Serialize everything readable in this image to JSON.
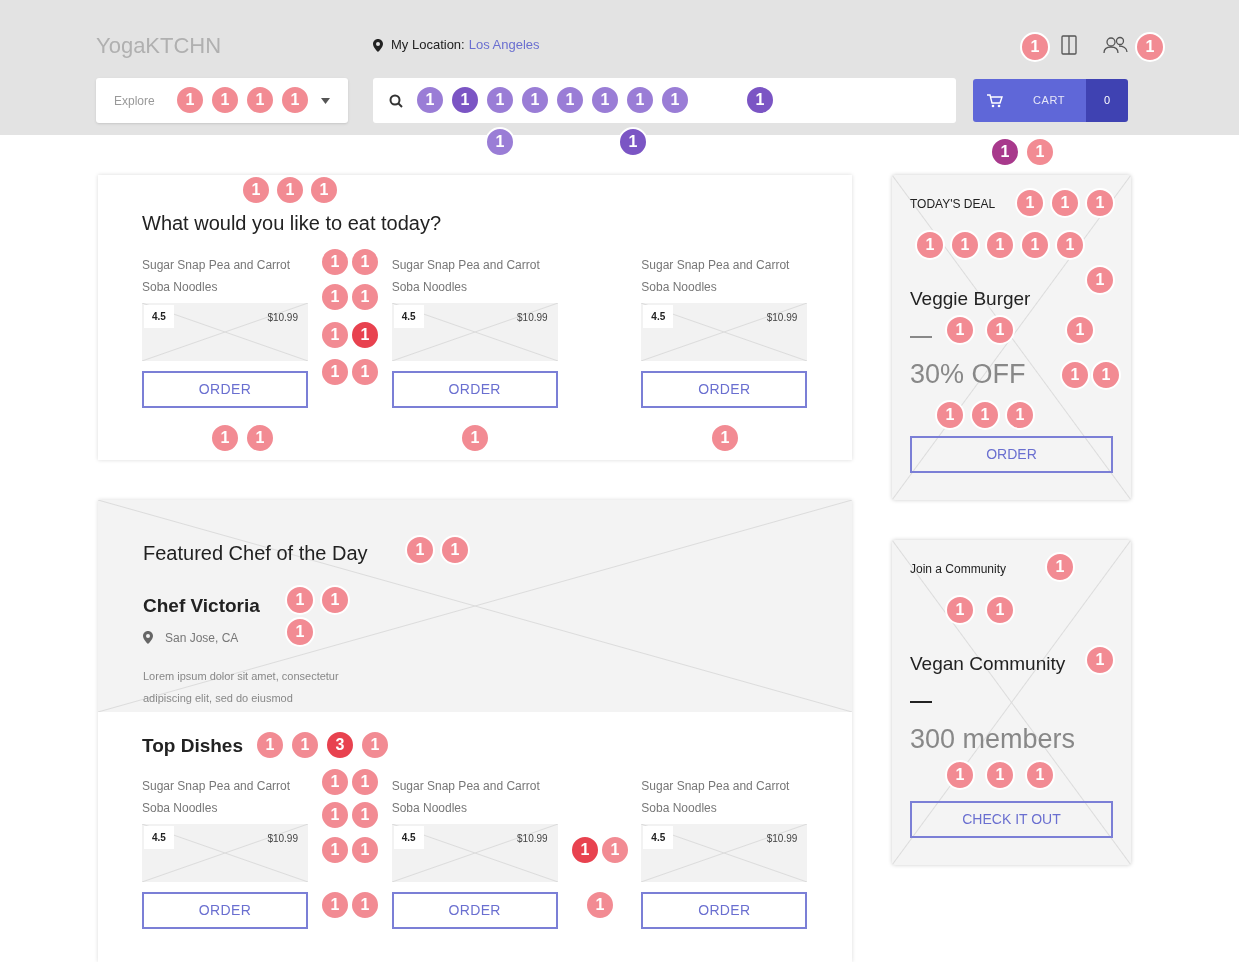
{
  "header": {
    "logo": "YogaKTCHN",
    "location_label": "My Location:",
    "location": "Los Angeles",
    "explore": "Explore",
    "cart": "CART",
    "cart_count": "0"
  },
  "eat_today": {
    "title": "What would you like to eat today?",
    "dishes": [
      {
        "name": "Sugar Snap Pea and Carrot Soba Noodles",
        "rating": "4.5",
        "price": "$10.99",
        "button": "ORDER"
      },
      {
        "name": "Sugar Snap Pea and Carrot Soba Noodles",
        "rating": "4.5",
        "price": "$10.99",
        "button": "ORDER"
      },
      {
        "name": "Sugar Snap Pea and Carrot Soba Noodles",
        "rating": "4.5",
        "price": "$10.99",
        "button": "ORDER"
      }
    ]
  },
  "featured": {
    "title": "Featured Chef of the Day",
    "chef": "Chef Victoria",
    "place": "San Jose, CA",
    "bio": "Lorem ipsum dolor sit amet, consectetur adipiscing elit, sed do eiusmod"
  },
  "top_dishes": {
    "title": "Top Dishes",
    "dishes": [
      {
        "name": "Sugar Snap Pea and Carrot Soba Noodles",
        "rating": "4.5",
        "price": "$10.99",
        "button": "ORDER"
      },
      {
        "name": "Sugar Snap Pea and Carrot Soba Noodles",
        "rating": "4.5",
        "price": "$10.99",
        "button": "ORDER"
      },
      {
        "name": "Sugar Snap Pea and Carrot Soba Noodles",
        "rating": "4.5",
        "price": "$10.99",
        "button": "ORDER"
      }
    ]
  },
  "deal": {
    "label": "TODAY'S DEAL",
    "item": "Veggie Burger",
    "offer": "30% OFF",
    "button": "ORDER"
  },
  "community": {
    "label": "Join a Community",
    "name": "Vegan Community",
    "members": "300 members",
    "button": "CHECK IT OUT"
  },
  "click_markers": [
    {
      "label": "1",
      "color": "#f28b93"
    },
    {
      "label": "1",
      "color": "#f28b93"
    },
    {
      "label": "1",
      "color": "#f28b93"
    },
    {
      "label": "1",
      "color": "#f28b93"
    },
    {
      "label": "1",
      "color": "#f28b93"
    },
    {
      "label": "1",
      "color": "#f28b93"
    },
    {
      "label": "1",
      "color": "#a8398c"
    },
    {
      "label": "1",
      "color": "#f28b93"
    },
    {
      "label": "1",
      "color": "#9a7dd6"
    },
    {
      "label": "1",
      "color": "#7b55c4"
    },
    {
      "label": "1",
      "color": "#9a7dd6"
    },
    {
      "label": "1",
      "color": "#9a7dd6"
    },
    {
      "label": "1",
      "color": "#9a7dd6"
    },
    {
      "label": "1",
      "color": "#9a7dd6"
    },
    {
      "label": "1",
      "color": "#9a7dd6"
    },
    {
      "label": "1",
      "color": "#9a7dd6"
    },
    {
      "label": "1",
      "color": "#7b55c4"
    },
    {
      "label": "1",
      "color": "#9a7dd6"
    },
    {
      "label": "1",
      "color": "#7b55c4"
    },
    {
      "label": "1",
      "color": "#f28b93"
    },
    {
      "label": "1",
      "color": "#f28b93"
    },
    {
      "label": "1",
      "color": "#f28b93"
    },
    {
      "label": "1",
      "color": "#f28b93"
    },
    {
      "label": "1",
      "color": "#f28b93"
    },
    {
      "label": "1",
      "color": "#f28b93"
    },
    {
      "label": "1",
      "color": "#f28b93"
    },
    {
      "label": "1",
      "color": "#f28b93"
    },
    {
      "label": "1",
      "color": "#e8424f"
    },
    {
      "label": "1",
      "color": "#f28b93"
    },
    {
      "label": "1",
      "color": "#f28b93"
    },
    {
      "label": "1",
      "color": "#f28b93"
    },
    {
      "label": "1",
      "color": "#f28b93"
    },
    {
      "label": "1",
      "color": "#f28b93"
    },
    {
      "label": "1",
      "color": "#f28b93"
    },
    {
      "label": "1",
      "color": "#f28b93"
    },
    {
      "label": "1",
      "color": "#f28b93"
    },
    {
      "label": "1",
      "color": "#f28b93"
    },
    {
      "label": "1",
      "color": "#f28b93"
    },
    {
      "label": "1",
      "color": "#f28b93"
    },
    {
      "label": "1",
      "color": "#f28b93"
    },
    {
      "label": "1",
      "color": "#f28b93"
    },
    {
      "label": "1",
      "color": "#f28b93"
    },
    {
      "label": "1",
      "color": "#f28b93"
    },
    {
      "label": "1",
      "color": "#f28b93"
    },
    {
      "label": "1",
      "color": "#f28b93"
    },
    {
      "label": "1",
      "color": "#f28b93"
    },
    {
      "label": "1",
      "color": "#f28b93"
    },
    {
      "label": "1",
      "color": "#f28b93"
    },
    {
      "label": "1",
      "color": "#f28b93"
    },
    {
      "label": "1",
      "color": "#f28b93"
    },
    {
      "label": "1",
      "color": "#f28b93"
    },
    {
      "label": "1",
      "color": "#f28b93"
    },
    {
      "label": "1",
      "color": "#f28b93"
    },
    {
      "label": "1",
      "color": "#f28b93"
    },
    {
      "label": "1",
      "color": "#f28b93"
    },
    {
      "label": "1",
      "color": "#f28b93"
    },
    {
      "label": "1",
      "color": "#f28b93"
    },
    {
      "label": "1",
      "color": "#f28b93"
    },
    {
      "label": "1",
      "color": "#f28b93"
    },
    {
      "label": "1",
      "color": "#f28b93"
    },
    {
      "label": "1",
      "color": "#f28b93"
    },
    {
      "label": "1",
      "color": "#f28b93"
    },
    {
      "label": "1",
      "color": "#f28b93"
    },
    {
      "label": "1",
      "color": "#f28b93"
    },
    {
      "label": "1",
      "color": "#f28b93"
    },
    {
      "label": "3",
      "color": "#e8424f"
    },
    {
      "label": "1",
      "color": "#f28b93"
    },
    {
      "label": "1",
      "color": "#f28b93"
    },
    {
      "label": "1",
      "color": "#f28b93"
    },
    {
      "label": "1",
      "color": "#f28b93"
    },
    {
      "label": "1",
      "color": "#f28b93"
    },
    {
      "label": "1",
      "color": "#f28b93"
    },
    {
      "label": "1",
      "color": "#f28b93"
    },
    {
      "label": "1",
      "color": "#e8424f"
    },
    {
      "label": "1",
      "color": "#f28b93"
    },
    {
      "label": "1",
      "color": "#f28b93"
    },
    {
      "label": "1",
      "color": "#f28b93"
    },
    {
      "label": "1",
      "color": "#f28b93"
    }
  ]
}
